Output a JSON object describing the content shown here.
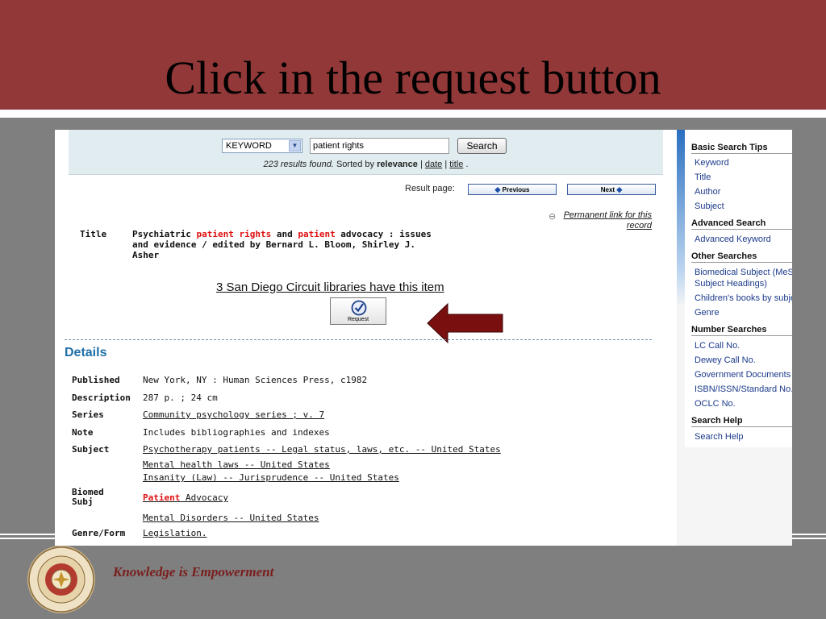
{
  "slide": {
    "title": "Click in the request button",
    "tagline": "Knowledge is Empowerment"
  },
  "search": {
    "type_value": "KEYWORD",
    "query_value": "patient rights",
    "button_label": "Search",
    "results_count": "223 results found.",
    "sorted_by": "Sorted by",
    "sort_relevance": "relevance",
    "sort_sep1": "|",
    "sort_date": "date",
    "sort_sep2": "|",
    "sort_title": "title",
    "sort_end": "."
  },
  "pagination": {
    "label": "Result page:",
    "previous": "Previous",
    "next": "Next"
  },
  "record": {
    "permalink": "Permanent link for this record",
    "title_label": "Title",
    "title_parts": [
      "Psychiatric ",
      "patient rights",
      " and ",
      "patient",
      " advocacy : issues and evidence / edited by Bernard L. Bloom, Shirley J. Asher"
    ],
    "holdings": "3 San Diego Circuit libraries have this item",
    "request_label": "Request"
  },
  "details": {
    "heading": "Details",
    "published_label": "Published",
    "published": "New York, NY : Human Sciences Press, c1982",
    "description_label": "Description",
    "description": "287 p. ; 24 cm",
    "series_label": "Series",
    "series": "Community psychology series ; v. 7",
    "note_label": "Note",
    "note": "Includes bibliographies and indexes",
    "subject_label": "Subject",
    "subjects": [
      "Psychotherapy patients -- Legal status, laws, etc. -- United States",
      "Mental health laws -- United States",
      "Insanity (Law) -- Jurisprudence -- United States"
    ],
    "biomed_label": "Biomed Subj",
    "biomed_hl": "Patient",
    "biomed_rest": " Advocacy",
    "biomed_2": "Mental Disorders -- United States",
    "genre_label": "Genre/Form",
    "genre": "Legislation."
  },
  "sidebar": {
    "basic_heading": "Basic Search Tips",
    "basic_items": [
      "Keyword",
      "Title",
      "Author",
      "Subject"
    ],
    "advanced_heading": "Advanced Search",
    "advanced_items": [
      "Advanced Keyword"
    ],
    "other_heading": "Other Searches",
    "other_items": [
      "Biomedical Subject (MeSH",
      "Subject Headings)",
      "Children's books by subject",
      "Genre"
    ],
    "number_heading": "Number Searches",
    "number_items": [
      "LC Call No.",
      "Dewey Call No.",
      "Government Documents",
      "ISBN/ISSN/Standard No.",
      "OCLC No."
    ],
    "help_heading": "Search Help",
    "help_items": [
      "Search Help"
    ]
  },
  "colors": {
    "header": "#933838",
    "arrow": "#7a0f0f",
    "highlight": "#e01010",
    "details_heading": "#1f6fa8"
  }
}
